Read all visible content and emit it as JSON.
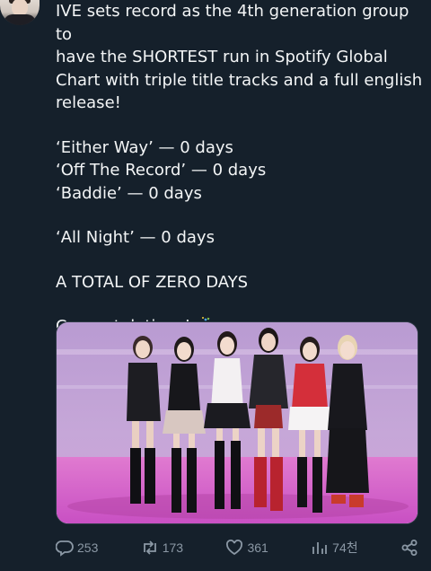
{
  "tweet": {
    "lines": [
      "IVE sets record as the 4th generation group to",
      "have the SHORTEST run in Spotify Global",
      "Chart with triple title tracks and a full english",
      "release!"
    ],
    "tracks": [
      "‘Either Way’ — 0 days",
      "‘Off The Record’ — 0 days",
      "‘Baddie’ — 0 days"
    ],
    "extra_track": "‘All Night’ — 0 days",
    "total": "A TOTAL OF ZERO DAYS",
    "closing": "Congratulations!",
    "closing_emoji": "party-popper-icon"
  },
  "actions": {
    "replies": "253",
    "reposts": "173",
    "likes": "361",
    "views": "74천"
  },
  "colors": {
    "background": "#15202b",
    "text": "#f3f5f6",
    "muted": "#8b98a5"
  }
}
